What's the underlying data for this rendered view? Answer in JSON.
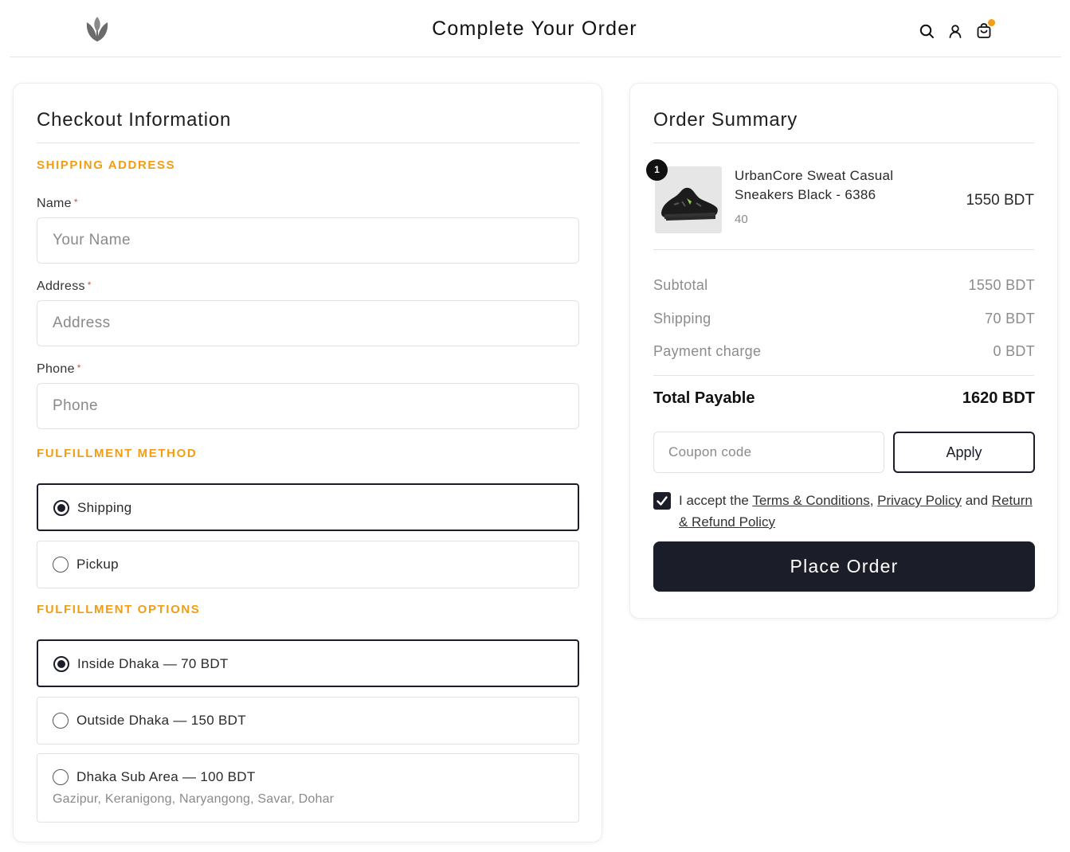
{
  "header": {
    "title": "Complete Your Order",
    "logo_icon": "leaf-logo-icon",
    "icons": [
      "search-icon",
      "user-icon",
      "cart-icon"
    ],
    "cart_badge_color": "#f29d12"
  },
  "checkout": {
    "title": "Checkout Information",
    "shipping_section": "SHIPPING ADDRESS",
    "fields": {
      "name": {
        "label": "Name",
        "required": "*",
        "placeholder": "Your Name"
      },
      "address": {
        "label": "Address",
        "required": "*",
        "placeholder": "Address"
      },
      "phone": {
        "label": "Phone",
        "required": "*",
        "placeholder": "Phone"
      }
    },
    "fulfillment_method_section": "FULFILLMENT METHOD",
    "fulfillment_methods": [
      {
        "label": "Shipping",
        "selected": true
      },
      {
        "label": "Pickup",
        "selected": false
      }
    ],
    "fulfillment_options_section": "FULFILLMENT OPTIONS",
    "fulfillment_options": [
      {
        "label": "Inside Dhaka — 70 BDT",
        "selected": true
      },
      {
        "label": "Outside Dhaka — 150 BDT",
        "selected": false
      },
      {
        "label": "Dhaka Sub Area — 100 BDT",
        "sub": "Gazipur, Keranigong, Naryangong, Savar, Dohar",
        "selected": false
      }
    ]
  },
  "summary": {
    "title": "Order Summary",
    "item": {
      "quantity": "1",
      "name": "UrbanCore Sweat Casual Sneakers Black - 6386",
      "variant": "40",
      "price": "1550 BDT"
    },
    "rows": {
      "subtotal": {
        "label": "Subtotal",
        "value": "1550 BDT"
      },
      "shipping": {
        "label": "Shipping",
        "value": "70 BDT"
      },
      "payment": {
        "label": "Payment charge",
        "value": "0 BDT"
      }
    },
    "total": {
      "label": "Total Payable",
      "value": "1620 BDT"
    },
    "coupon_placeholder": "Coupon code",
    "apply_label": "Apply",
    "terms": {
      "prefix": "I accept the ",
      "terms_link": "Terms & Conditions",
      "comma": ", ",
      "privacy_link": "Privacy Policy",
      "and": " and ",
      "refund_link": "Return & Refund Policy",
      "checked": true
    },
    "place_order_label": "Place Order"
  },
  "colors": {
    "accent": "#f29d12",
    "primary": "#1b1d29",
    "required": "#e0453a"
  }
}
